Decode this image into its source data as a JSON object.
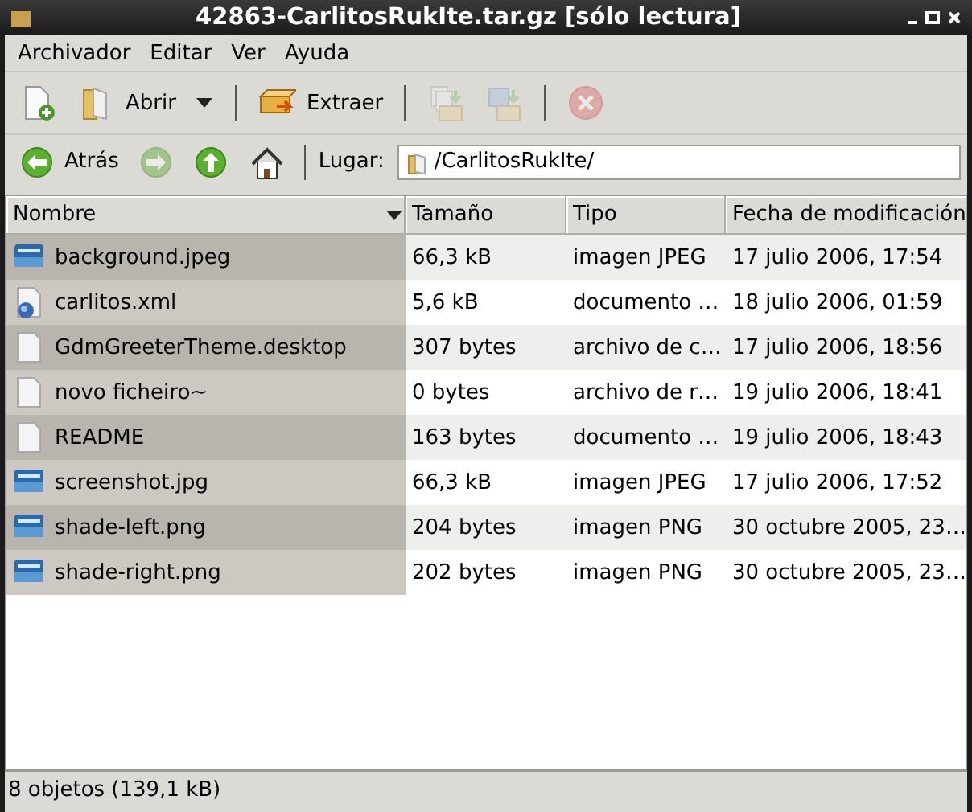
{
  "window": {
    "title": "42863-CarlitosRukIte.tar.gz [sólo lectura]"
  },
  "menu": [
    "Archivador",
    "Editar",
    "Ver",
    "Ayuda"
  ],
  "toolbar": [
    {
      "kind": "new",
      "disabled": false
    },
    {
      "kind": "open",
      "label": "Abrir",
      "disabled": false
    },
    {
      "kind": "dropdown",
      "disabled": false
    },
    {
      "kind": "separator"
    },
    {
      "kind": "extract",
      "label": "Extraer",
      "disabled": false
    },
    {
      "kind": "separator"
    },
    {
      "kind": "add-files",
      "disabled": true
    },
    {
      "kind": "add-folder",
      "disabled": true
    },
    {
      "kind": "separator"
    },
    {
      "kind": "stop",
      "disabled": true
    }
  ],
  "navigation": [
    {
      "kind": "back",
      "label": "Atrás",
      "disabled": false
    },
    {
      "kind": "forward",
      "disabled": true
    },
    {
      "kind": "up",
      "disabled": false
    },
    {
      "kind": "home",
      "disabled": false
    }
  ],
  "location": {
    "label": "Lugar:",
    "value": "/CarlitosRukIte/"
  },
  "table": {
    "columns": [
      {
        "label": "Nombre",
        "sorted": true
      },
      {
        "label": "Tamaño",
        "sorted": false
      },
      {
        "label": "Tipo",
        "sorted": false
      },
      {
        "label": "Fecha de modificación",
        "sorted": false
      }
    ],
    "rows": [
      {
        "kind": "image",
        "cells": [
          "background.jpeg",
          "66,3 kB",
          "imagen JPEG",
          "17 julio 2006, 17:54"
        ]
      },
      {
        "kind": "xml",
        "cells": [
          "carlitos.xml",
          "5,6 kB",
          "documento …",
          "18 julio 2006, 01:59"
        ]
      },
      {
        "kind": "text",
        "cells": [
          "GdmGreeterTheme.desktop",
          "307 bytes",
          "archivo de c…",
          "17 julio 2006, 18:56"
        ]
      },
      {
        "kind": "text",
        "cells": [
          "novo ficheiro~",
          "0 bytes",
          "archivo de r…",
          "19 julio 2006, 18:41"
        ]
      },
      {
        "kind": "text",
        "cells": [
          "README",
          "163 bytes",
          "documento …",
          "19 julio 2006, 18:43"
        ]
      },
      {
        "kind": "image",
        "cells": [
          "screenshot.jpg",
          "66,3 kB",
          "imagen JPEG",
          "17 julio 2006, 17:52"
        ]
      },
      {
        "kind": "image",
        "cells": [
          "shade-left.png",
          "204 bytes",
          "imagen PNG",
          "30 octubre 2005, 23…"
        ]
      },
      {
        "kind": "image",
        "cells": [
          "shade-right.png",
          "202 bytes",
          "imagen PNG",
          "30 octubre 2005, 23…"
        ]
      }
    ]
  },
  "status_bar": "8 objetos (139,1 kB)"
}
